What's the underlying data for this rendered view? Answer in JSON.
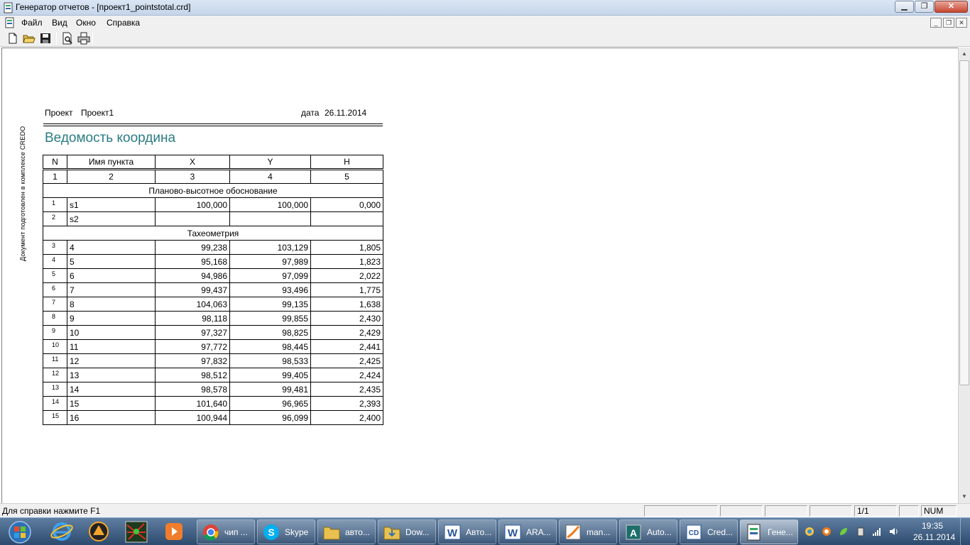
{
  "window": {
    "title": "Генератор отчетов - [проект1_pointstotal.crd]",
    "controls": {
      "minimize": "▁",
      "maximize": "❐",
      "close": "✕"
    }
  },
  "menu": {
    "items": [
      "Файл",
      "Вид",
      "Окно",
      "Справка"
    ],
    "mdi_controls": {
      "minimize": "_",
      "restore": "❐",
      "close": "✕"
    }
  },
  "toolbar": {
    "buttons": [
      "new-document-icon",
      "open-folder-icon",
      "save-icon",
      "print-preview-icon",
      "print-icon"
    ]
  },
  "report": {
    "side_text": "Документ подготовлен в комплексе CREDO",
    "project_label": "Проект",
    "project_value": "Проект1",
    "date_label": "дата",
    "date_value": "26.11.2014",
    "title": "Ведомость координа",
    "columns": [
      "N",
      "Имя пункта",
      "X",
      "Y",
      "H"
    ],
    "column_numbers": [
      "1",
      "2",
      "3",
      "4",
      "5"
    ],
    "sections": [
      {
        "name": "Планово-высотное обоснование",
        "rows": [
          {
            "n": "1",
            "name": "s1",
            "x": "100,000",
            "y": "100,000",
            "h": "0,000"
          },
          {
            "n": "2",
            "name": "s2",
            "x": "",
            "y": "",
            "h": ""
          }
        ]
      },
      {
        "name": "Тахеометрия",
        "rows": [
          {
            "n": "3",
            "name": "4",
            "x": "99,238",
            "y": "103,129",
            "h": "1,805"
          },
          {
            "n": "4",
            "name": "5",
            "x": "95,168",
            "y": "97,989",
            "h": "1,823"
          },
          {
            "n": "5",
            "name": "6",
            "x": "94,986",
            "y": "97,099",
            "h": "2,022"
          },
          {
            "n": "6",
            "name": "7",
            "x": "99,437",
            "y": "93,496",
            "h": "1,775"
          },
          {
            "n": "7",
            "name": "8",
            "x": "104,063",
            "y": "99,135",
            "h": "1,638"
          },
          {
            "n": "8",
            "name": "9",
            "x": "98,118",
            "y": "99,855",
            "h": "2,430"
          },
          {
            "n": "9",
            "name": "10",
            "x": "97,327",
            "y": "98,825",
            "h": "2,429"
          },
          {
            "n": "10",
            "name": "11",
            "x": "97,772",
            "y": "98,445",
            "h": "2,441"
          },
          {
            "n": "11",
            "name": "12",
            "x": "97,832",
            "y": "98,533",
            "h": "2,425"
          },
          {
            "n": "12",
            "name": "13",
            "x": "98,512",
            "y": "99,405",
            "h": "2,424"
          },
          {
            "n": "13",
            "name": "14",
            "x": "98,578",
            "y": "99,481",
            "h": "2,435"
          },
          {
            "n": "14",
            "name": "15",
            "x": "101,640",
            "y": "96,965",
            "h": "2,393"
          },
          {
            "n": "15",
            "name": "16",
            "x": "100,944",
            "y": "96,099",
            "h": "2,400"
          }
        ]
      }
    ]
  },
  "statusbar": {
    "help_text": "Для справки нажмите  F1",
    "page": "1/1",
    "num": "NUM"
  },
  "taskbar": {
    "tasks": [
      {
        "label": "чип ...",
        "icon": "chrome-icon"
      },
      {
        "label": "Skype",
        "icon": "skype-icon"
      },
      {
        "label": "авто...",
        "icon": "folder-icon"
      },
      {
        "label": "Dow...",
        "icon": "downloads-folder-icon"
      },
      {
        "label": "Авто...",
        "icon": "word-icon"
      },
      {
        "label": "ARA...",
        "icon": "word-icon"
      },
      {
        "label": "man...",
        "icon": "pdf-viewer-icon"
      },
      {
        "label": "Auto...",
        "icon": "autocad-icon"
      },
      {
        "label": "Cred...",
        "icon": "credo-icon"
      },
      {
        "label": "Гене...",
        "icon": "report-generator-icon"
      }
    ],
    "clock_time": "19:35",
    "clock_date": "26.11.2014"
  }
}
